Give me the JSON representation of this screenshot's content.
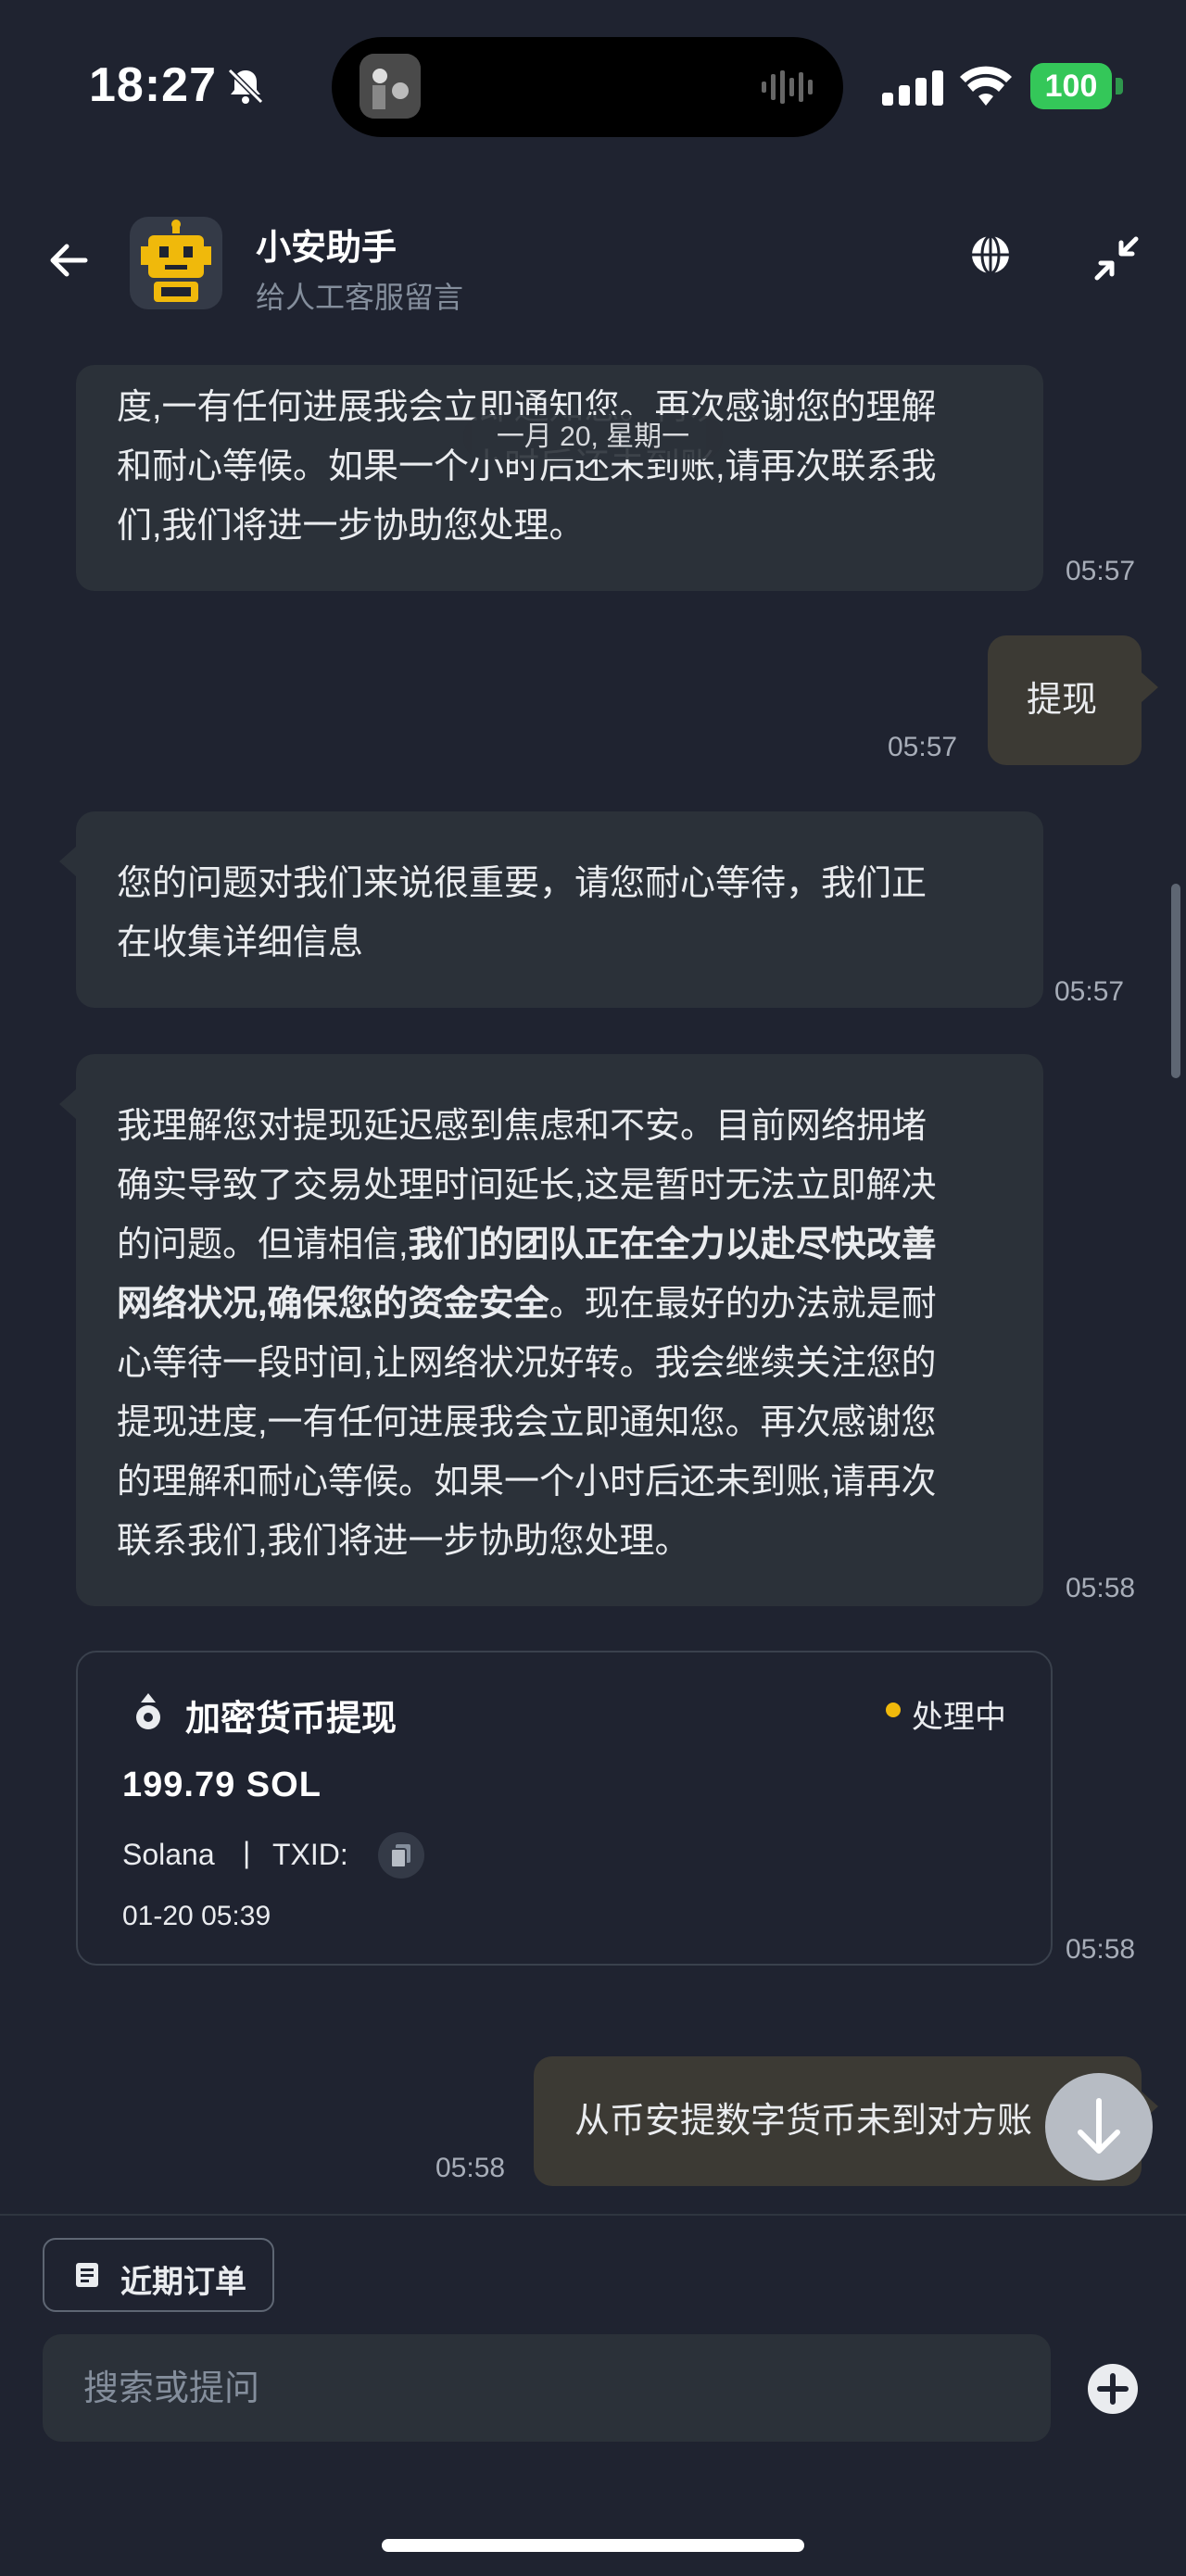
{
  "status_bar": {
    "time": "18:27",
    "battery": "100"
  },
  "header": {
    "title": "小安助手",
    "subtitle": "给人工客服留言"
  },
  "date_divider": "一月 20, 星期一",
  "messages": [
    {
      "text_lines": [
        "度,一有任何进展我会立即通知您。再次感谢您的理解",
        "和耐心等候。如果一个小时后还未到账,请再次联系我",
        "们,我们将进一步协助您处理。"
      ],
      "time": "05:57"
    },
    {
      "text": "提现",
      "time": "05:57"
    },
    {
      "text_lines": [
        "您的问题对我们来说很重要，请您耐心等待，我们正",
        "在收集详细信息"
      ],
      "time": "05:57"
    },
    {
      "line1": "我理解您对提现延迟感到焦虑和不安。目前网络拥堵",
      "line2": "确实导致了交易处理时间延长,这是暂时无法立即解决",
      "line3_plain": "的问题。但请相信,",
      "line3_bold": "我们的团队正在全力以赴尽快改善",
      "line4_bold": "网络状况,确保您的资金安全",
      "line4_plain": "。现在最好的办法就是耐",
      "line5": "心等待一段时间,让网络状况好转。我会继续关注您的",
      "line6": "提现进度,一有任何进展我会立即通知您。再次感谢您",
      "line7": "的理解和耐心等候。如果一个小时后还未到账,请再次",
      "line8": "联系我们,我们将进一步协助您处理。",
      "time": "05:58"
    },
    {
      "text": "从币安提数字货币未到对方账",
      "time": "05:58"
    }
  ],
  "withdraw_card": {
    "title": "加密货币提现",
    "status": "处理中",
    "amount": "199.79 SOL",
    "network": "Solana",
    "separator": "|",
    "txid_label": "TXID:",
    "datetime": "01-20 05:39",
    "time": "05:58",
    "status_color": "#f0b90b"
  },
  "bottom": {
    "recent_orders": "近期订单",
    "input_placeholder": "搜索或提问"
  },
  "icons": [
    "silent-bell-icon",
    "back-arrow-icon",
    "robot-avatar-icon",
    "globe-icon",
    "collapse-icon",
    "crypto-withdraw-icon",
    "copy-icon",
    "scroll-down-icon",
    "orders-icon",
    "plus-circle-icon"
  ]
}
